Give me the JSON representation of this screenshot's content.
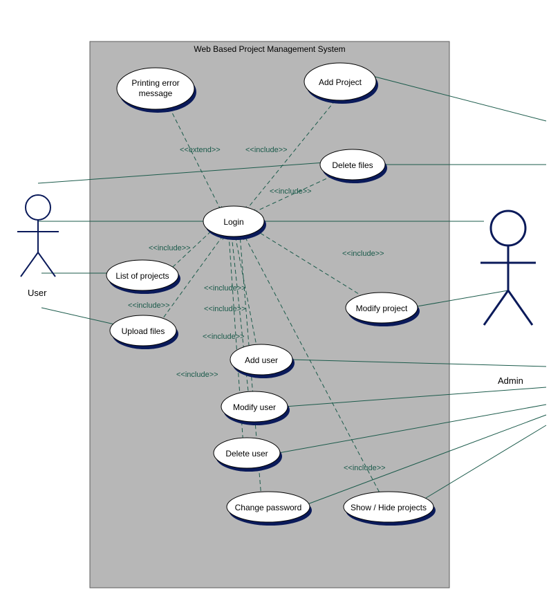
{
  "system": {
    "title": "Web Based Project Management System"
  },
  "actors": {
    "user": "User",
    "admin": "Admin"
  },
  "usecases": {
    "printing_error": "Printing error\nmessage",
    "add_project": "Add Project",
    "delete_files": "Delete files",
    "login": "Login",
    "list_projects": "List of projects",
    "modify_project": "Modify project",
    "upload_files": "Upload files",
    "add_user": "Add user",
    "modify_user": "Modify user",
    "delete_user": "Delete user",
    "change_password": "Change password",
    "show_hide_projects": "Show / Hide projects"
  },
  "stereotypes": {
    "extend": "<<extend>>",
    "include": "<<include>>"
  }
}
